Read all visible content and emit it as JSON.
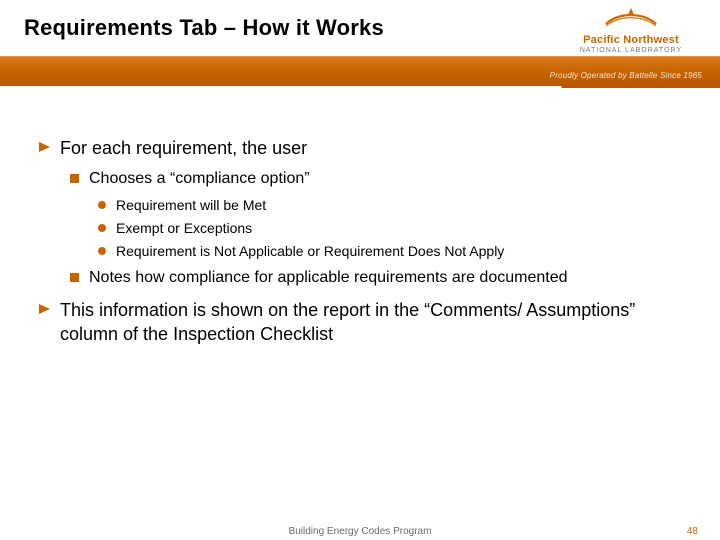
{
  "header": {
    "title": "Requirements Tab – How it Works",
    "logo": {
      "line1": "Pacific Northwest",
      "line2": "NATIONAL LABORATORY",
      "tagline": "Proudly Operated by Battelle Since 1965"
    }
  },
  "bullets": {
    "l1_0": "For each requirement, the user",
    "l1_1": "This information is shown on the report in the “Comments/ Assumptions” column of the Inspection Checklist",
    "l2_0": "Chooses a “compliance option”",
    "l2_1": "Notes how compliance for applicable requirements are documented",
    "l3_0": "Requirement will be Met",
    "l3_1": "Exempt or Exceptions",
    "l3_2": "Requirement is Not Applicable or Requirement Does Not Apply"
  },
  "footer": {
    "center": "Building Energy Codes Program",
    "page_number": "48"
  },
  "colors": {
    "accent": "#c86400"
  }
}
